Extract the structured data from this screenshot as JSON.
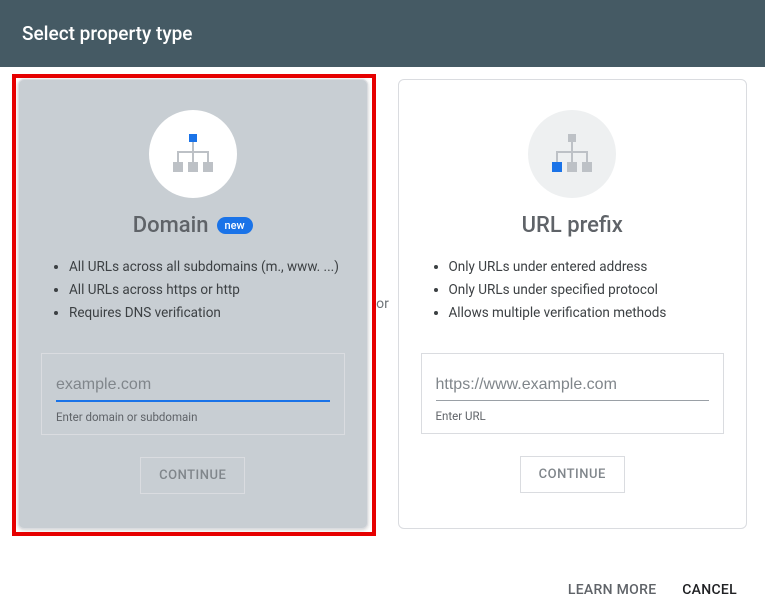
{
  "header": {
    "title": "Select property type"
  },
  "separator": "or",
  "domain_card": {
    "title": "Domain",
    "badge": "new",
    "features": [
      "All URLs across all subdomains (m., www. ...)",
      "All URLs across https or http",
      "Requires DNS verification"
    ],
    "placeholder": "example.com",
    "helper": "Enter domain or subdomain",
    "button": "CONTINUE"
  },
  "prefix_card": {
    "title": "URL prefix",
    "features": [
      "Only URLs under entered address",
      "Only URLs under specified protocol",
      "Allows multiple verification methods"
    ],
    "placeholder": "https://www.example.com",
    "helper": "Enter URL",
    "button": "CONTINUE"
  },
  "footer": {
    "learn_more": "LEARN MORE",
    "cancel": "CANCEL"
  }
}
